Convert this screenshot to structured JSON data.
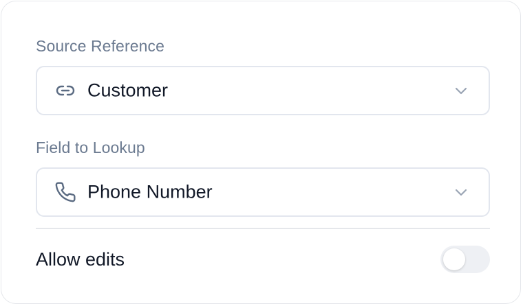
{
  "source_reference": {
    "label": "Source Reference",
    "value": "Customer",
    "icon": "link-icon"
  },
  "field_to_lookup": {
    "label": "Field to Lookup",
    "value": "Phone Number",
    "icon": "phone-icon"
  },
  "allow_edits": {
    "label": "Allow edits",
    "enabled": false
  },
  "colors": {
    "label": "#6b7a90",
    "text": "#111827",
    "border": "#e2e6ee",
    "icon": "#5b6b82",
    "toggle_off": "#eef0f4"
  }
}
